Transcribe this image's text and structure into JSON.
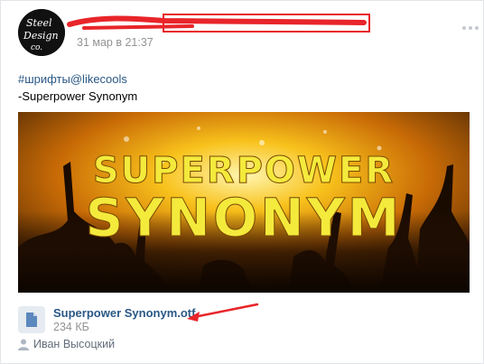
{
  "post": {
    "date": "31 мар в 21:37",
    "hashtag": "#шрифты@likecools",
    "text": "-Superpower Synonym"
  },
  "avatar": {
    "logo_text_1": "Steel",
    "logo_text_2": "Design",
    "logo_text_3": "co."
  },
  "image": {
    "title_line_1": "SUPERPOWER",
    "title_line_2": "SYNONYM",
    "title_color": "#f4ea3c",
    "glow_color": "#f6c21a"
  },
  "attachment": {
    "file_name": "Superpower Synonym.otf",
    "file_size": "234 КБ",
    "icon": "document-icon"
  },
  "author": {
    "name": "Иван Высоцкий",
    "icon": "user-icon"
  },
  "colors": {
    "link": "#2a5885",
    "muted": "#939393",
    "annotation_red": "#e8252a"
  }
}
